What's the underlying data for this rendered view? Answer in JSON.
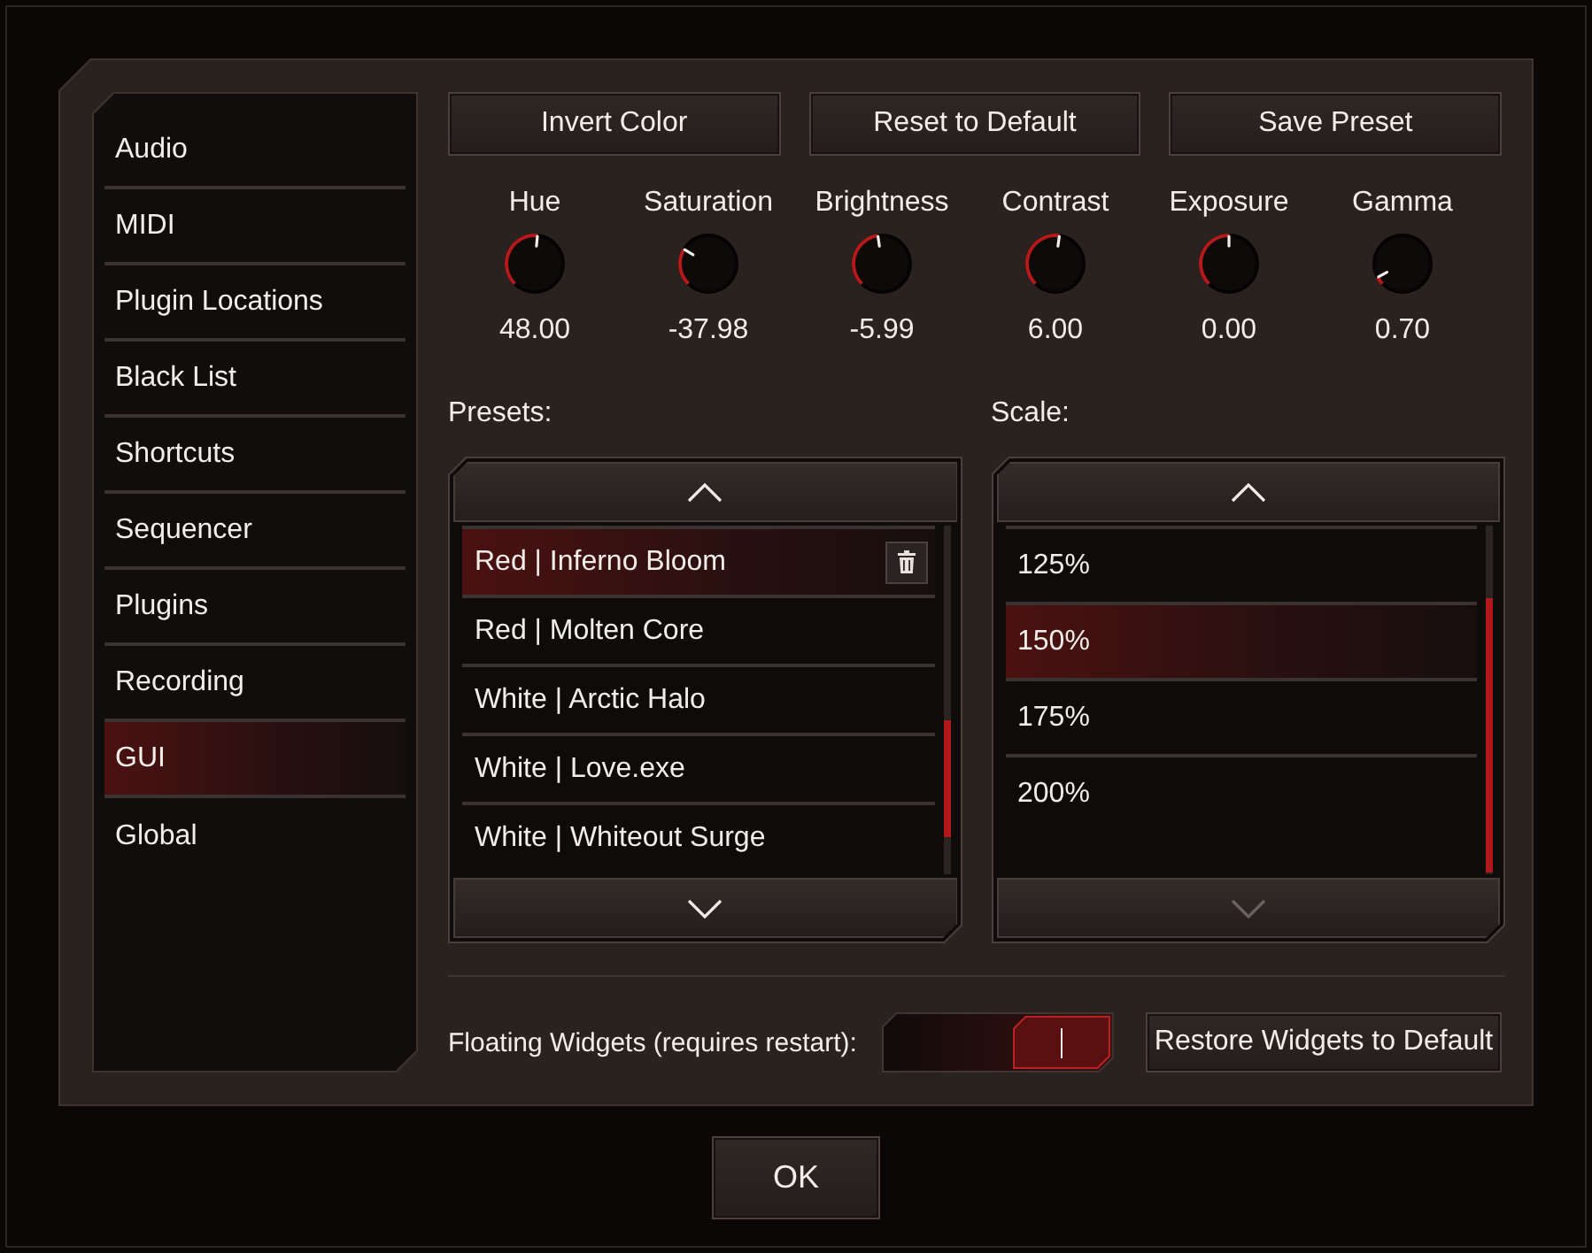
{
  "sidebar": {
    "items": [
      {
        "label": "Audio",
        "selected": false
      },
      {
        "label": "MIDI",
        "selected": false
      },
      {
        "label": "Plugin Locations",
        "selected": false
      },
      {
        "label": "Black List",
        "selected": false
      },
      {
        "label": "Shortcuts",
        "selected": false
      },
      {
        "label": "Sequencer",
        "selected": false
      },
      {
        "label": "Plugins",
        "selected": false
      },
      {
        "label": "Recording",
        "selected": false
      },
      {
        "label": "GUI",
        "selected": true
      },
      {
        "label": "Global",
        "selected": false
      }
    ]
  },
  "actions": [
    "Invert Color",
    "Reset to Default",
    "Save Preset"
  ],
  "knobs": [
    {
      "label": "Hue",
      "value": "48.00",
      "level": 0.52
    },
    {
      "label": "Saturation",
      "value": "-37.98",
      "level": 0.28
    },
    {
      "label": "Brightness",
      "value": "-5.99",
      "level": 0.47
    },
    {
      "label": "Contrast",
      "value": "6.00",
      "level": 0.53
    },
    {
      "label": "Exposure",
      "value": "0.00",
      "level": 0.5
    },
    {
      "label": "Gamma",
      "value": "0.70",
      "level": 0.06
    }
  ],
  "presets": {
    "label": "Presets:",
    "up_button": {
      "disabled": false
    },
    "down_button": {
      "disabled": false
    },
    "items": [
      {
        "label": "Red | Inferno Bloom",
        "selected": true
      },
      {
        "label": "Red | Molten Core",
        "selected": false
      },
      {
        "label": "White | Arctic Halo",
        "selected": false
      },
      {
        "label": "White | Love.exe",
        "selected": false
      },
      {
        "label": "White | Whiteout Surge",
        "selected": false
      }
    ]
  },
  "scale": {
    "label": "Scale:",
    "up_button": {
      "disabled": false
    },
    "down_button": {
      "disabled": true
    },
    "items": [
      {
        "label": "125%",
        "selected": false
      },
      {
        "label": "150%",
        "selected": true
      },
      {
        "label": "175%",
        "selected": false
      },
      {
        "label": "200%",
        "selected": false
      }
    ]
  },
  "floating_widgets": {
    "label": "Floating Widgets (requires restart):",
    "on": true
  },
  "restore_button": {
    "label": "Restore Widgets to Default"
  },
  "ok_button": {
    "label": "OK"
  }
}
